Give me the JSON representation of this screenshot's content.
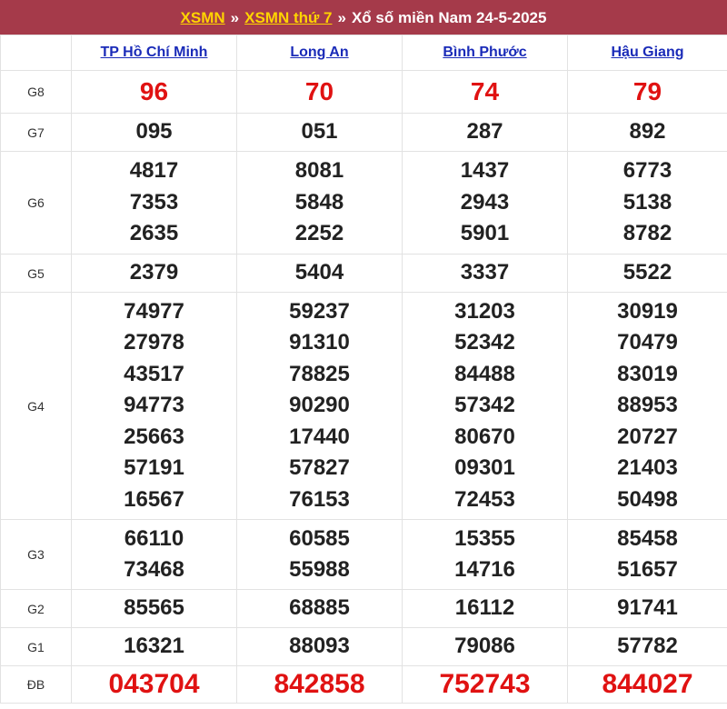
{
  "header": {
    "link1": "XSMN",
    "sep1": "»",
    "link2": "XSMN thứ 7",
    "sep2": "»",
    "text": "Xổ số miền Nam 24-5-2025"
  },
  "provinces": [
    "TP Hồ Chí Minh",
    "Long An",
    "Bình Phước",
    "Hậu Giang"
  ],
  "prizes": [
    {
      "label": "G8",
      "results": [
        [
          "96"
        ],
        [
          "70"
        ],
        [
          "74"
        ],
        [
          "79"
        ]
      ]
    },
    {
      "label": "G7",
      "results": [
        [
          "095"
        ],
        [
          "051"
        ],
        [
          "287"
        ],
        [
          "892"
        ]
      ]
    },
    {
      "label": "G6",
      "results": [
        [
          "4817",
          "7353",
          "2635"
        ],
        [
          "8081",
          "5848",
          "2252"
        ],
        [
          "1437",
          "2943",
          "5901"
        ],
        [
          "6773",
          "5138",
          "8782"
        ]
      ]
    },
    {
      "label": "G5",
      "results": [
        [
          "2379"
        ],
        [
          "5404"
        ],
        [
          "3337"
        ],
        [
          "5522"
        ]
      ]
    },
    {
      "label": "G4",
      "results": [
        [
          "74977",
          "27978",
          "43517",
          "94773",
          "25663",
          "57191",
          "16567"
        ],
        [
          "59237",
          "91310",
          "78825",
          "90290",
          "17440",
          "57827",
          "76153"
        ],
        [
          "31203",
          "52342",
          "84488",
          "57342",
          "80670",
          "09301",
          "72453"
        ],
        [
          "30919",
          "70479",
          "83019",
          "88953",
          "20727",
          "21403",
          "50498"
        ]
      ]
    },
    {
      "label": "G3",
      "results": [
        [
          "66110",
          "73468"
        ],
        [
          "60585",
          "55988"
        ],
        [
          "15355",
          "14716"
        ],
        [
          "85458",
          "51657"
        ]
      ]
    },
    {
      "label": "G2",
      "results": [
        [
          "85565"
        ],
        [
          "68885"
        ],
        [
          "16112"
        ],
        [
          "91741"
        ]
      ]
    },
    {
      "label": "G1",
      "results": [
        [
          "16321"
        ],
        [
          "88093"
        ],
        [
          "79086"
        ],
        [
          "57782"
        ]
      ]
    },
    {
      "label": "ĐB",
      "results": [
        [
          "043704"
        ],
        [
          "842858"
        ],
        [
          "752743"
        ],
        [
          "844027"
        ]
      ]
    }
  ]
}
